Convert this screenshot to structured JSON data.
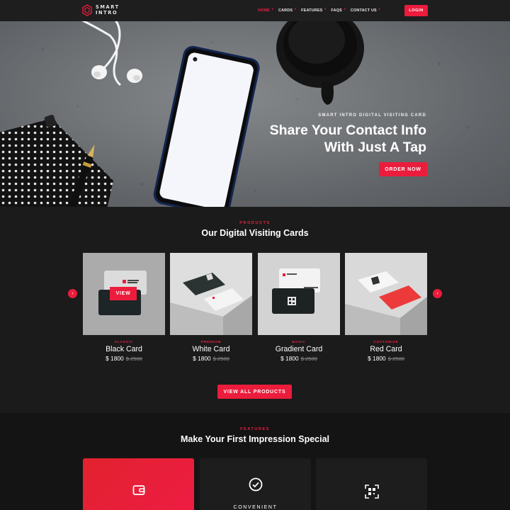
{
  "brand": {
    "line1": "SMART",
    "line2": "INTRO"
  },
  "nav": {
    "items": [
      {
        "label": "HOME",
        "active": true
      },
      {
        "label": "CARDS",
        "active": false
      },
      {
        "label": "FEATURES",
        "active": false
      },
      {
        "label": "FAQS",
        "active": false
      },
      {
        "label": "CONTACT US",
        "active": false
      }
    ],
    "login_label": "LOGIN"
  },
  "hero": {
    "eyebrow": "SMART INTRO DIGITAL VISITING CARD",
    "title_line1": "Share Your Contact Info",
    "title_line2": "With Just A Tap",
    "cta_label": "ORDER NOW"
  },
  "products": {
    "eyebrow": "PRODUCTS",
    "title": "Our Digital Visiting Cards",
    "currency": "$",
    "view_label": "VIEW",
    "view_all_label": "VIEW ALL PRODUCTS",
    "prev_icon": "chevron-left-icon",
    "next_icon": "chevron-right-icon",
    "items": [
      {
        "category": "CLASSIC",
        "name": "Black Card",
        "price": "$ 1800",
        "old_price": "$ 2500"
      },
      {
        "category": "PREMIUM",
        "name": "White Card",
        "price": "$ 1800",
        "old_price": "$ 2500"
      },
      {
        "category": "BASIC",
        "name": "Gradient Card",
        "price": "$ 1800",
        "old_price": "$ 2500"
      },
      {
        "category": "CUSTOMIZE",
        "name": "Red Card",
        "price": "$ 1800",
        "old_price": "$ 2500"
      }
    ]
  },
  "features": {
    "eyebrow": "FEATURES",
    "title": "Make Your First Impression Special",
    "items": [
      {
        "icon": "wallet-icon",
        "label": ""
      },
      {
        "icon": "check-circle-icon",
        "label": "CONVENIENT"
      },
      {
        "icon": "qr-code-icon",
        "label": ""
      }
    ]
  },
  "colors": {
    "accent": "#ec1c3c",
    "background": "#1b1b1b",
    "nav": "#1e1e1e"
  }
}
